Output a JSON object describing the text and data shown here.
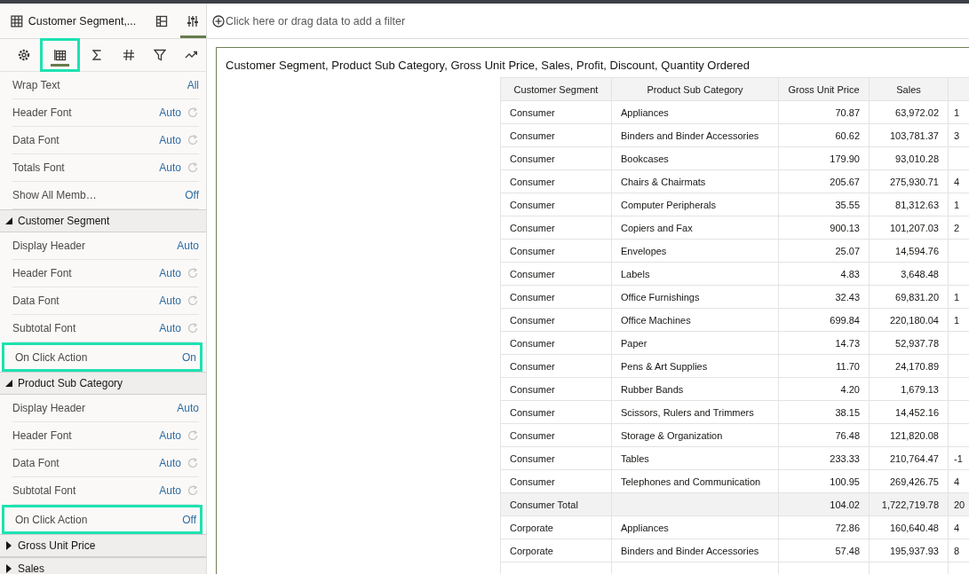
{
  "panel_header": {
    "title": "Customer Segment,...",
    "view_buttons": [
      {
        "kind": "layout",
        "selected": false
      },
      {
        "kind": "properties",
        "selected": true
      }
    ]
  },
  "filter_bar": {
    "placeholder": "Click here or drag data to add a filter"
  },
  "property_tabs": [
    {
      "kind": "general",
      "selected": false,
      "highlighted": false
    },
    {
      "kind": "table",
      "selected": true,
      "highlighted": true
    },
    {
      "kind": "sum",
      "selected": false,
      "highlighted": false
    },
    {
      "kind": "number",
      "selected": false,
      "highlighted": false
    },
    {
      "kind": "filter",
      "selected": false,
      "highlighted": false
    },
    {
      "kind": "analytics",
      "selected": false,
      "highlighted": false
    }
  ],
  "general_properties": [
    {
      "label": "Wrap Text",
      "value": "All",
      "kind": "plain",
      "highlighted": false
    },
    {
      "label": "Header Font",
      "value": "Auto",
      "kind": "reset",
      "highlighted": false
    },
    {
      "label": "Data Font",
      "value": "Auto",
      "kind": "reset",
      "highlighted": false
    },
    {
      "label": "Totals Font",
      "value": "Auto",
      "kind": "reset",
      "highlighted": false
    },
    {
      "label": "Show All Memb…",
      "value": "Off",
      "kind": "plain",
      "highlighted": false
    }
  ],
  "sections": [
    {
      "title": "Customer Segment",
      "expanded": true,
      "properties": [
        {
          "label": "Display Header",
          "value": "Auto",
          "kind": "plain",
          "highlighted": false
        },
        {
          "label": "Header Font",
          "value": "Auto",
          "kind": "reset",
          "highlighted": false
        },
        {
          "label": "Data Font",
          "value": "Auto",
          "kind": "reset",
          "highlighted": false
        },
        {
          "label": "Subtotal Font",
          "value": "Auto",
          "kind": "reset",
          "highlighted": false
        },
        {
          "label": "On Click Action",
          "value": "On",
          "kind": "plain",
          "highlighted": true
        }
      ]
    },
    {
      "title": "Product Sub Category",
      "expanded": true,
      "properties": [
        {
          "label": "Display Header",
          "value": "Auto",
          "kind": "plain",
          "highlighted": false
        },
        {
          "label": "Header Font",
          "value": "Auto",
          "kind": "reset",
          "highlighted": false
        },
        {
          "label": "Data Font",
          "value": "Auto",
          "kind": "reset",
          "highlighted": false
        },
        {
          "label": "Subtotal Font",
          "value": "Auto",
          "kind": "reset",
          "highlighted": false
        },
        {
          "label": "On Click Action",
          "value": "Off",
          "kind": "plain",
          "highlighted": true
        }
      ]
    },
    {
      "title": "Gross Unit Price",
      "expanded": false
    },
    {
      "title": "Sales",
      "expanded": false
    }
  ],
  "canvas": {
    "title": "Customer Segment, Product Sub Category, Gross Unit Price, Sales, Profit, Discount, Quantity Ordered",
    "table": {
      "columns": [
        "Customer Segment",
        "Product Sub Category",
        "Gross Unit Price",
        "Sales"
      ],
      "rows": [
        {
          "total": false,
          "cells": [
            "Consumer",
            "Appliances",
            "70.87",
            "63,972.02",
            "1"
          ]
        },
        {
          "total": false,
          "cells": [
            "Consumer",
            "Binders and Binder Accessories",
            "60.62",
            "103,781.37",
            "3"
          ]
        },
        {
          "total": false,
          "cells": [
            "Consumer",
            "Bookcases",
            "179.90",
            "93,010.28"
          ]
        },
        {
          "total": false,
          "cells": [
            "Consumer",
            "Chairs & Chairmats",
            "205.67",
            "275,930.71",
            "4"
          ]
        },
        {
          "total": false,
          "cells": [
            "Consumer",
            "Computer Peripherals",
            "35.55",
            "81,312.63",
            "1"
          ]
        },
        {
          "total": false,
          "cells": [
            "Consumer",
            "Copiers and Fax",
            "900.13",
            "101,207.03",
            "2"
          ]
        },
        {
          "total": false,
          "cells": [
            "Consumer",
            "Envelopes",
            "25.07",
            "14,594.76"
          ]
        },
        {
          "total": false,
          "cells": [
            "Consumer",
            "Labels",
            "4.83",
            "3,648.48"
          ]
        },
        {
          "total": false,
          "cells": [
            "Consumer",
            "Office Furnishings",
            "32.43",
            "69,831.20",
            "1"
          ]
        },
        {
          "total": false,
          "cells": [
            "Consumer",
            "Office Machines",
            "699.84",
            "220,180.04",
            "1"
          ]
        },
        {
          "total": false,
          "cells": [
            "Consumer",
            "Paper",
            "14.73",
            "52,937.78"
          ]
        },
        {
          "total": false,
          "cells": [
            "Consumer",
            "Pens & Art Supplies",
            "11.70",
            "24,170.89"
          ]
        },
        {
          "total": false,
          "cells": [
            "Consumer",
            "Rubber Bands",
            "4.20",
            "1,679.13"
          ]
        },
        {
          "total": false,
          "cells": [
            "Consumer",
            "Scissors, Rulers and Trimmers",
            "38.15",
            "14,452.16"
          ]
        },
        {
          "total": false,
          "cells": [
            "Consumer",
            "Storage & Organization",
            "76.48",
            "121,820.08"
          ]
        },
        {
          "total": false,
          "cells": [
            "Consumer",
            "Tables",
            "233.33",
            "210,764.47",
            "-1"
          ]
        },
        {
          "total": false,
          "cells": [
            "Consumer",
            "Telephones and Communication",
            "100.95",
            "269,426.75",
            "4"
          ]
        },
        {
          "total": true,
          "cells": [
            "Consumer Total",
            "",
            "104.02",
            "1,722,719.78",
            "20"
          ]
        },
        {
          "total": false,
          "cells": [
            "Corporate",
            "Appliances",
            "72.86",
            "160,640.48",
            "4"
          ]
        },
        {
          "total": false,
          "cells": [
            "Corporate",
            "Binders and Binder Accessories",
            "57.48",
            "195,937.93",
            "8"
          ]
        },
        {
          "total": false,
          "cells": []
        }
      ]
    }
  }
}
